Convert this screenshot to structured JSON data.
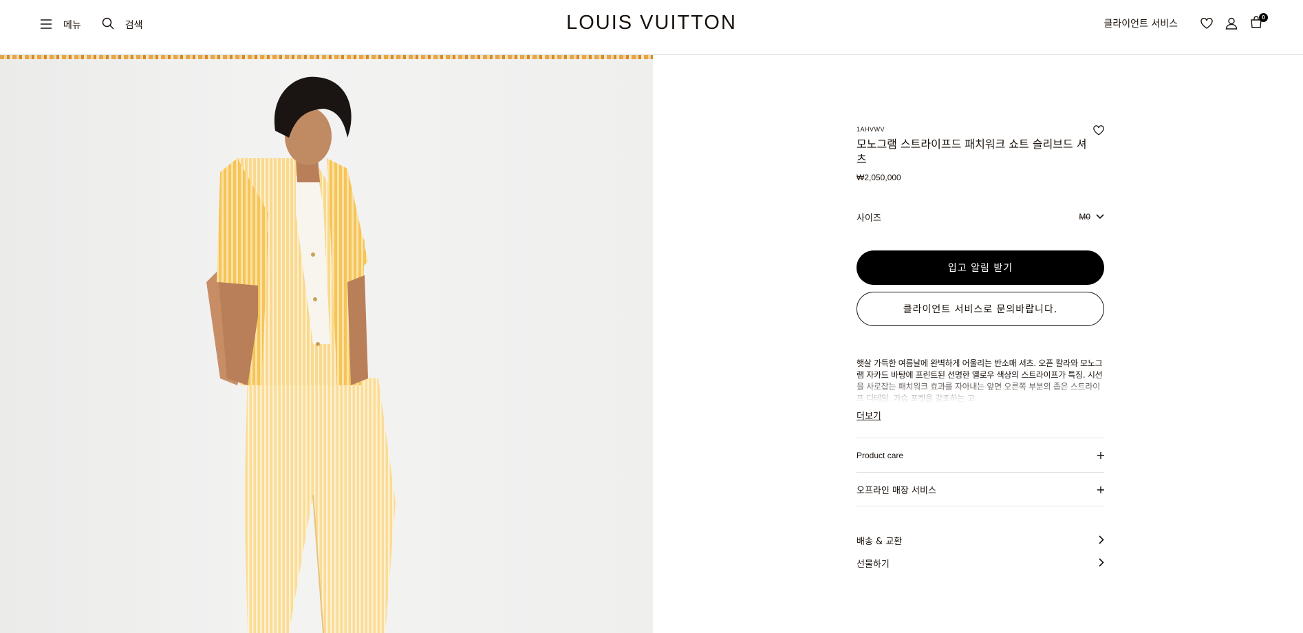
{
  "header": {
    "menu_label": "메뉴",
    "search_label": "검색",
    "logo": "LOUIS VUITTON",
    "client_service": "클라이언트 서비스",
    "cart_count": "0"
  },
  "product": {
    "sku": "1AHVWV",
    "title": "모노그램 스트라이프드 패치워크 쇼트 슬리브드 셔츠",
    "price": "₩2,050,000",
    "size_label": "사이즈",
    "size_value": "M0",
    "notify_button": "입고 알림 받기",
    "contact_button": "클라이언트 서비스로 문의바랍니다.",
    "description": "햇살 가득한 여름날에 완벽하게 어울리는 반소매 셔츠. 오픈 칼라와 모노그램 자카드 바탕에 프린트된 선명한 옐로우 색상의 스트라이프가 특징. 시선을 사로잡는 패치워크 효과를 자아내는 앞면 오른쪽 부분의 좁은 스트라이프 디테일. 가슴 포켓을 강조하는 고",
    "more_label": "더보기"
  },
  "accordions": [
    {
      "label": "Product care"
    },
    {
      "label": "오프라인 매장 서비스"
    }
  ],
  "links": [
    {
      "label": "배송 & 교환"
    },
    {
      "label": "선물하기"
    }
  ],
  "colors": {
    "text": "#19110b",
    "primary_button": "#000000",
    "divider": "#e1e1e1",
    "shirt_yellow": "#f2b640"
  }
}
